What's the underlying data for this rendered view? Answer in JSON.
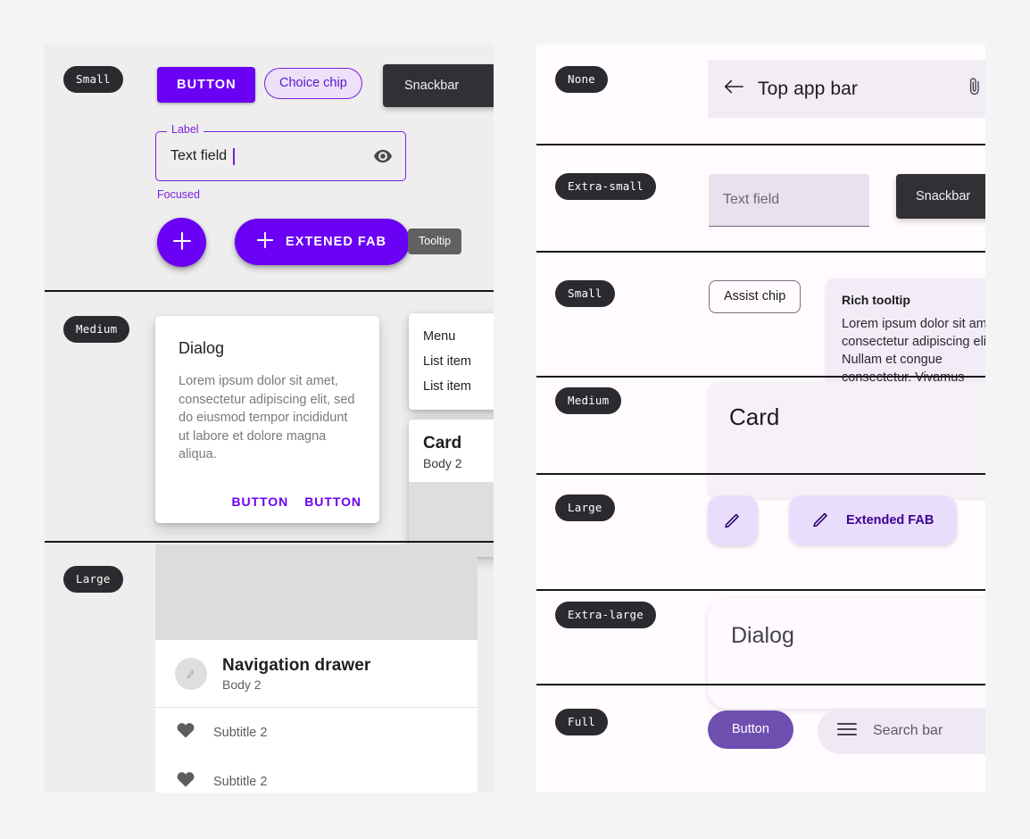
{
  "left_panel": {
    "rows": [
      {
        "size_label": "Small",
        "button_label": "BUTTON",
        "chip_label": "Choice chip",
        "snackbar_label": "Snackbar",
        "text_field": {
          "legend": "Label",
          "value": "Text field",
          "helper": "Focused",
          "trailing_icon": "eye-icon"
        },
        "fab_icon": "plus-icon",
        "extended_fab_label": "EXTENED FAB",
        "extended_fab_icon": "plus-icon",
        "tooltip_label": "Tooltip"
      },
      {
        "size_label": "Medium",
        "dialog": {
          "title": "Dialog",
          "body": "Lorem ipsum dolor sit amet, consectetur adipiscing elit, sed do eiusmod tempor incididunt ut labore et dolore magna aliqua.",
          "action_1": "BUTTON",
          "action_2": "BUTTON"
        },
        "menu": {
          "header": "Menu",
          "items": [
            "List item",
            "List item"
          ]
        },
        "card": {
          "title": "Card",
          "subtitle": "Body 2"
        }
      },
      {
        "size_label": "Large",
        "navigation_drawer": {
          "title": "Navigation drawer",
          "subtitle": "Body 2",
          "avatar_icon": "avatar-icon",
          "items": [
            {
              "icon": "heart-icon",
              "label": "Subtitle 2"
            },
            {
              "icon": "heart-icon",
              "label": "Subtitle 2"
            }
          ]
        }
      }
    ]
  },
  "right_panel": {
    "rows": [
      {
        "size_label": "None",
        "top_app_bar": {
          "back_icon": "arrow-left-icon",
          "title": "Top app bar",
          "trailing_icon": "attachment-icon"
        }
      },
      {
        "size_label": "Extra-small",
        "text_field_placeholder": "Text field",
        "snackbar_label": "Snackbar"
      },
      {
        "size_label": "Small",
        "assist_chip_label": "Assist chip",
        "rich_tooltip": {
          "title": "Rich tooltip",
          "body": "Lorem ipsum dolor sit amet, consectetur adipiscing elit. Nullam et congue consectetur. Vivamus"
        }
      },
      {
        "size_label": "Medium",
        "card_title": "Card"
      },
      {
        "size_label": "Large",
        "fab_icon": "pencil-icon",
        "extended_fab_label": "Extended FAB",
        "extended_fab_icon": "pencil-icon"
      },
      {
        "size_label": "Extra-large",
        "dialog_title": "Dialog"
      },
      {
        "size_label": "Full",
        "button_label": "Button",
        "search_bar": {
          "menu_icon": "hamburger-icon",
          "placeholder": "Search bar"
        }
      }
    ]
  },
  "colors": {
    "page_background": "#f4f4f4",
    "left_panel_background": "#eeeeee",
    "right_panel_background": "#fffbff",
    "primary_purple": "#6a00f4",
    "chip_dark": "#2b2a2e",
    "snackbar_dark": "#323034",
    "container_lavender": "#e9ddfc",
    "on_container_purple": "#3d0091"
  }
}
